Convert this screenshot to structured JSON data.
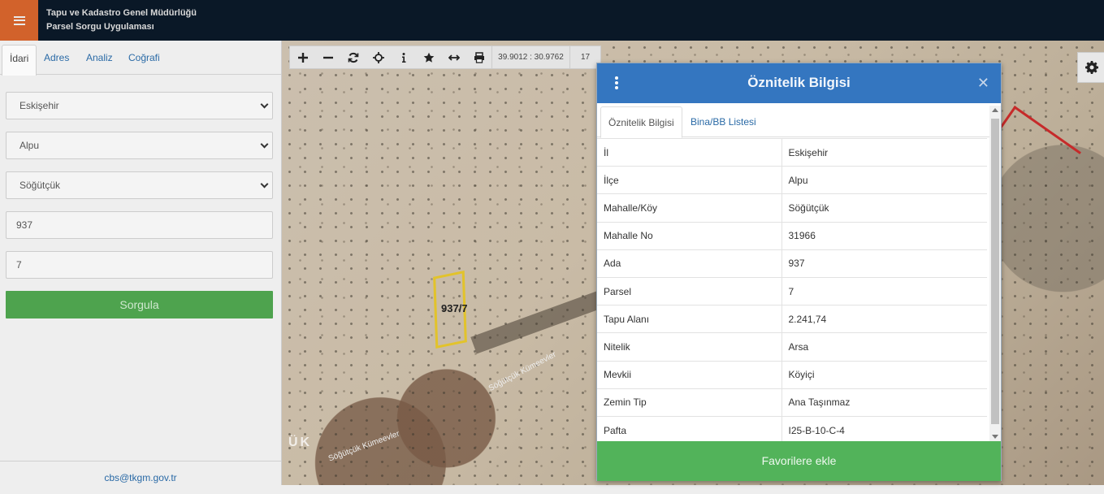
{
  "header": {
    "title_line1": "Tapu ve Kadastro Genel Müdürlüğü",
    "title_line2": "Parsel Sorgu Uygulaması",
    "menu_icon": "hamburger-menu-icon",
    "menu_color": "#d2622b"
  },
  "sidebar": {
    "tabs": [
      {
        "label": "İdari",
        "active": true
      },
      {
        "label": "Adres"
      },
      {
        "label": "Analiz"
      },
      {
        "label": "Coğrafi"
      }
    ],
    "province": "Eskişehir",
    "district": "Alpu",
    "neighborhood": "Söğütçük",
    "block": "937",
    "parcel": "7",
    "submit_label": "Sorgula",
    "footer_email": "cbs@tkgm.gov.tr"
  },
  "map": {
    "parcel_label": "937/7",
    "street_label": "Söğütçük Kümeevler",
    "street_label_2": "Söğütçük Kümeevler",
    "area_label": "ÜK",
    "coordinates": "39.9012 : 30.9762",
    "zoom_level": "17",
    "tools": [
      "zoom-in-icon",
      "zoom-out-icon",
      "refresh-icon",
      "locate-icon",
      "info-icon",
      "star-icon",
      "measure-icon",
      "print-icon"
    ]
  },
  "dialog": {
    "title": "Öznitelik Bilgisi",
    "tabs": [
      {
        "label": "Öznitelik Bilgisi",
        "active": true
      },
      {
        "label": "Bina/BB Listesi"
      }
    ],
    "rows": [
      {
        "key": "İl",
        "value": "Eskişehir"
      },
      {
        "key": "İlçe",
        "value": "Alpu"
      },
      {
        "key": "Mahalle/Köy",
        "value": "Söğütçük"
      },
      {
        "key": "Mahalle No",
        "value": "31966"
      },
      {
        "key": "Ada",
        "value": "937"
      },
      {
        "key": "Parsel",
        "value": "7"
      },
      {
        "key": "Tapu Alanı",
        "value": "2.241,74"
      },
      {
        "key": "Nitelik",
        "value": "Arsa"
      },
      {
        "key": "Mevkii",
        "value": "Köyiçi"
      },
      {
        "key": "Zemin Tip",
        "value": "Ana Taşınmaz"
      },
      {
        "key": "Pafta",
        "value": "I25-B-10-C-4"
      }
    ],
    "favorite_label": "Favorilere ekle",
    "header_color": "#3476c0",
    "button_color": "#52b35a"
  }
}
